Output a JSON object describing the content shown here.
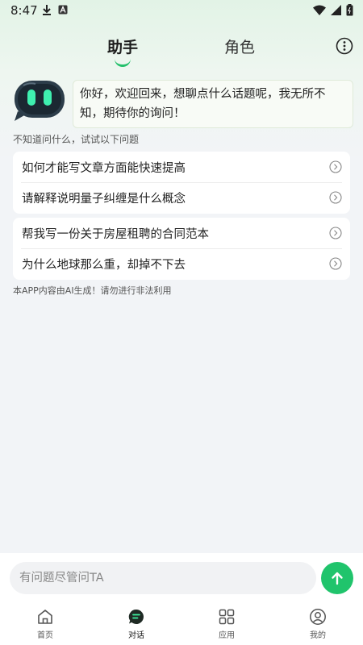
{
  "status_bar": {
    "time": "8:47",
    "left_icons": [
      "download-icon",
      "a-icon"
    ],
    "right_icons": [
      "wifi-icon",
      "signal-icon",
      "battery-icon"
    ]
  },
  "tabs": [
    {
      "label": "助手",
      "active": true
    },
    {
      "label": "角色",
      "active": false
    }
  ],
  "greeting": "你好，欢迎回来，想聊点什么话题呢，我无所不知，期待你的询问！",
  "hint": "不知道问什么，试试以下问题",
  "suggestion_groups": [
    [
      "如何才能写文章方面能快速提高",
      "请解释说明量子纠缠是什么概念"
    ],
    [
      "帮我写一份关于房屋租聘的合同范本",
      "为什么地球那么重，却掉不下去"
    ]
  ],
  "disclaimer": "本APP内容由AI生成！请勿进行非法利用",
  "input": {
    "placeholder": "有问题尽管问TA",
    "value": ""
  },
  "nav": [
    {
      "label": "首页",
      "icon": "home-icon",
      "active": false
    },
    {
      "label": "对话",
      "icon": "chat-icon",
      "active": true
    },
    {
      "label": "应用",
      "icon": "apps-grid-icon",
      "active": false
    },
    {
      "label": "我的",
      "icon": "profile-icon",
      "active": false
    }
  ],
  "colors": {
    "accent": "#20c46c",
    "background": "#f2f4f7"
  }
}
